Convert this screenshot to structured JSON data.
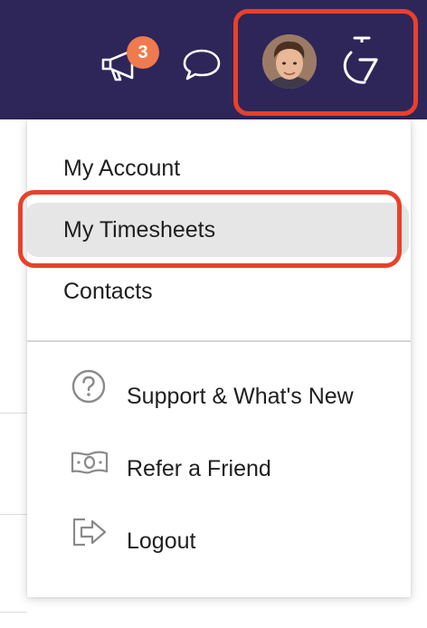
{
  "header": {
    "notifications": {
      "icon": "megaphone-icon",
      "badge_count": "3",
      "badge_color": "#ef7a4f"
    },
    "chat": {
      "icon": "chat-bubble-icon"
    },
    "profile": {
      "icon": "user-avatar"
    },
    "timer": {
      "icon": "stopwatch-7-icon"
    },
    "background_color": "#2e2559",
    "highlight_color": "#e8412b"
  },
  "menu": {
    "items": [
      {
        "label": "My Account"
      },
      {
        "label": "My Timesheets",
        "highlighted": true
      },
      {
        "label": "Contacts"
      }
    ],
    "secondary_items": [
      {
        "label": "Support & What's New",
        "icon": "question-circle-icon"
      },
      {
        "label": "Refer a Friend",
        "icon": "money-bill-icon"
      },
      {
        "label": "Logout",
        "icon": "logout-icon"
      }
    ]
  }
}
